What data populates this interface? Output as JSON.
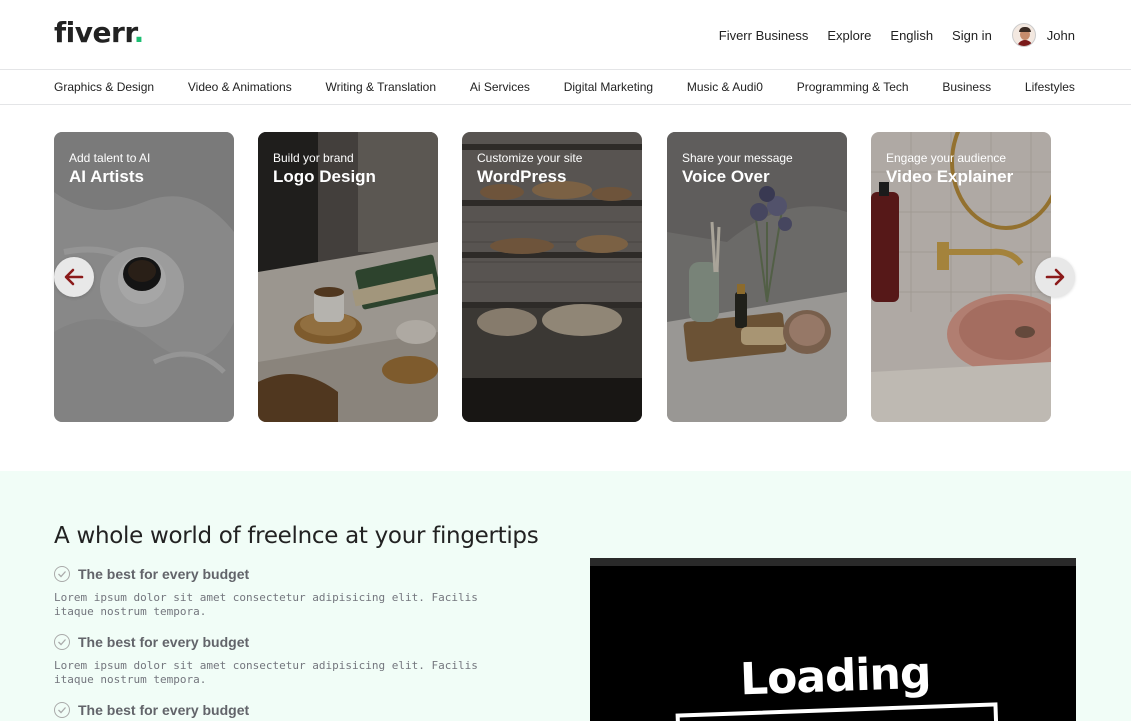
{
  "brand": {
    "name": "fiverr",
    "dot": ".",
    "accent": "#1dbf73"
  },
  "top_nav": {
    "items": [
      "Fiverr Business",
      "Explore",
      "English",
      "Sign in"
    ],
    "user_name": "John"
  },
  "categories": [
    "Graphics & Design",
    "Video & Animations",
    "Writing & Translation",
    "Ai Services",
    "Digital Marketing",
    "Music & Audi0",
    "Programming & Tech",
    "Business",
    "Lifestyles"
  ],
  "carousel": {
    "cards": [
      {
        "subtitle": "Add talent to AI",
        "title": "AI Artists"
      },
      {
        "subtitle": "Build yor brand",
        "title": "Logo Design"
      },
      {
        "subtitle": "Customize your site",
        "title": "WordPress"
      },
      {
        "subtitle": "Share your message",
        "title": "Voice Over"
      },
      {
        "subtitle": "Engage your audience",
        "title": "Video Explainer"
      }
    ],
    "prev_icon": "arrow-left-icon",
    "next_icon": "arrow-right-icon",
    "arrow_color": "#8b1a1a"
  },
  "features": {
    "heading": "A whole world of freelnce at your fingertips",
    "items": [
      {
        "title": "The best for every budget",
        "desc": "Lorem ipsum dolor sit amet consectetur adipisicing elit. Facilis itaque nostrum tempora."
      },
      {
        "title": "The best for every budget",
        "desc": "Lorem ipsum dolor sit amet consectetur adipisicing elit. Facilis itaque nostrum tempora."
      },
      {
        "title": "The best for every budget",
        "desc": ""
      }
    ],
    "check_icon": "check-circle-icon",
    "section_bg": "#f1fdf7"
  },
  "video": {
    "loading_text": "Loading"
  }
}
